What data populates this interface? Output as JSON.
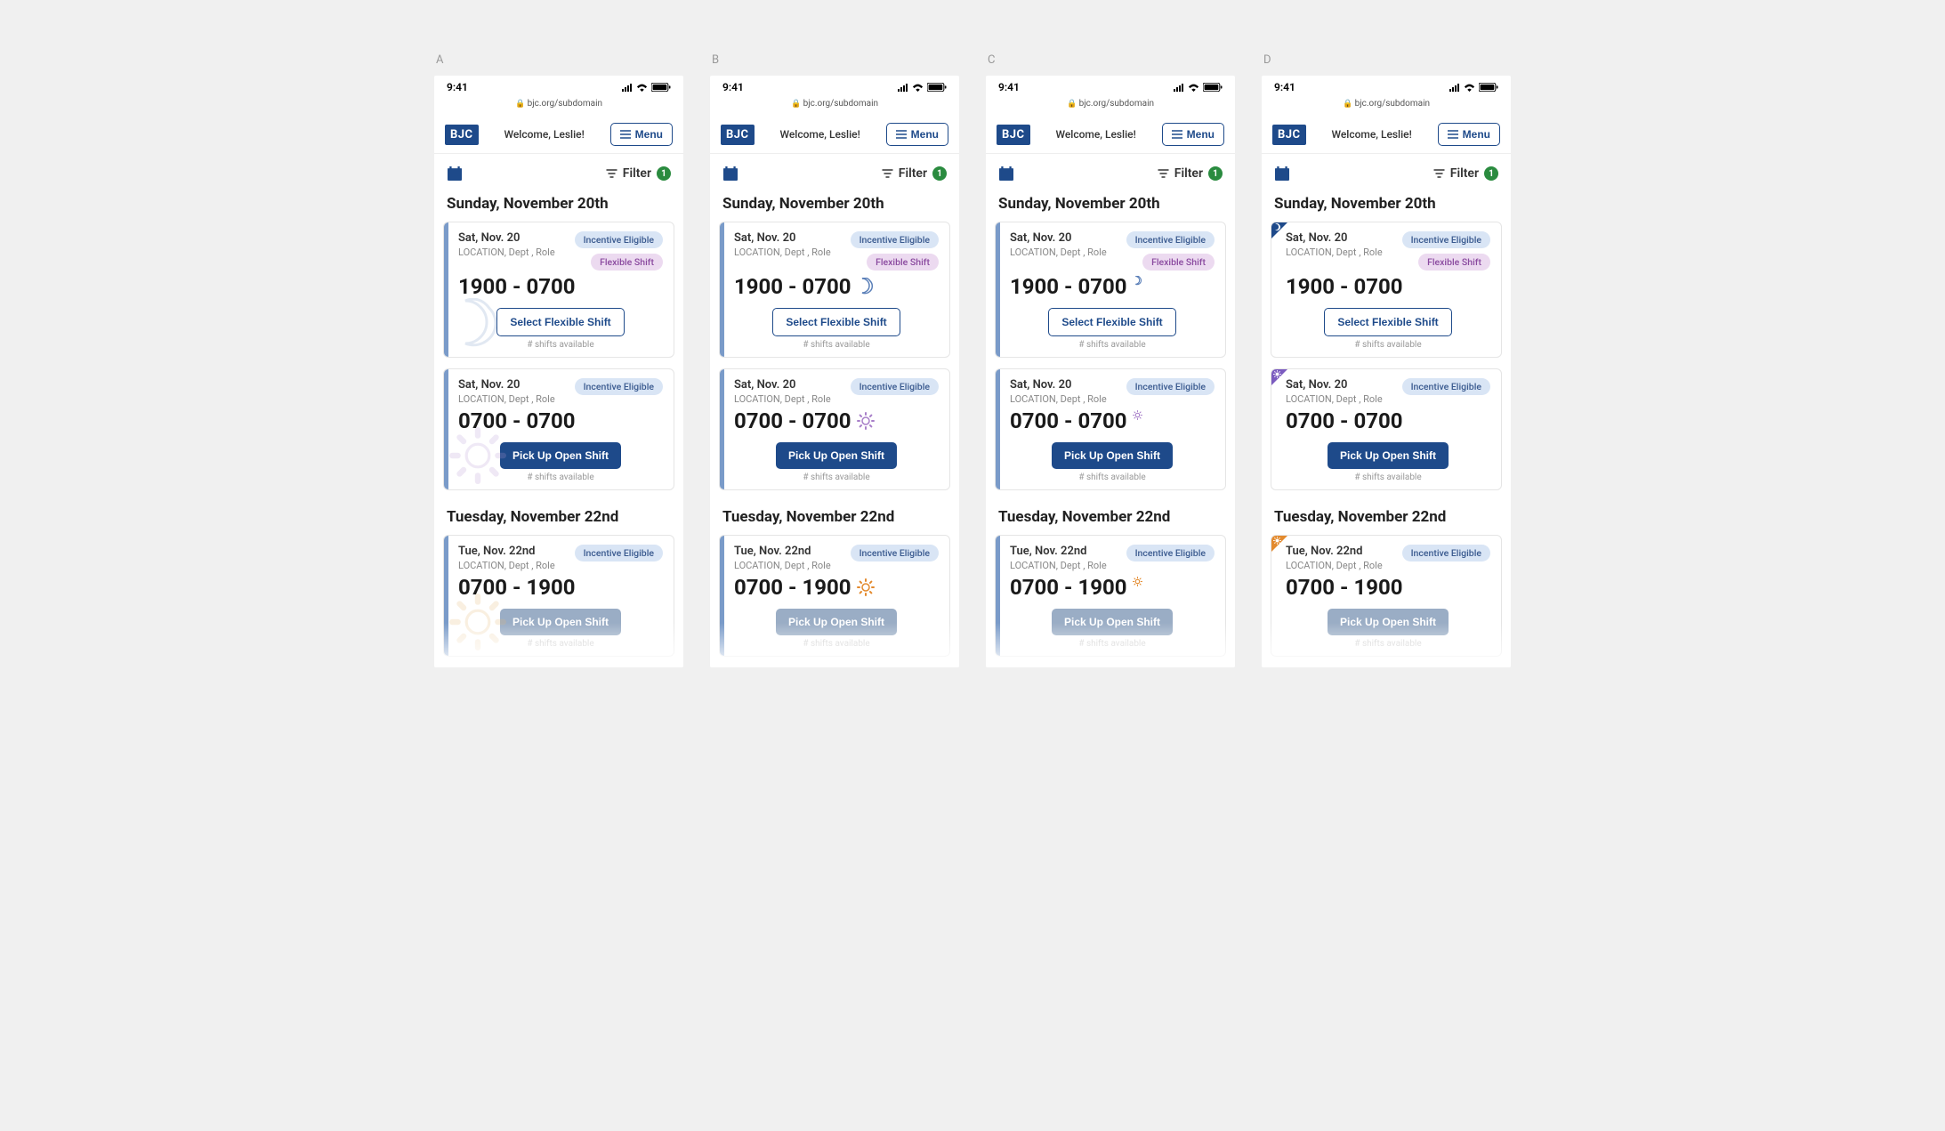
{
  "variants": [
    "A",
    "B",
    "C",
    "D"
  ],
  "status": {
    "time": "9:41"
  },
  "url": "bjc.org/subdomain",
  "header": {
    "logo": "BJC",
    "welcome": "Welcome, Leslie!",
    "menu_label": "Menu"
  },
  "filter": {
    "label": "Filter",
    "count": "1"
  },
  "day1": {
    "header": "Sunday, November 20th"
  },
  "day2": {
    "header": "Tuesday, November 22nd"
  },
  "card1": {
    "date": "Sat, Nov. 20",
    "meta": "LOCATION, Dept , Role",
    "time": "1900 - 0700",
    "badge_incentive": "Incentive Eligible",
    "badge_flex": "Flexible Shift",
    "button": "Select Flexible Shift",
    "avail": "# shifts available"
  },
  "card2": {
    "date": "Sat, Nov. 20",
    "meta": "LOCATION, Dept , Role",
    "time": "0700 - 0700",
    "badge_incentive": "Incentive Eligible",
    "button": "Pick Up Open Shift",
    "avail": "# shifts available"
  },
  "card3": {
    "date": "Tue, Nov. 22nd",
    "meta": "LOCATION, Dept , Role",
    "time": "0700 - 1900",
    "badge_incentive": "Incentive Eligible",
    "button": "Pick Up Open Shift",
    "avail": "# shifts available"
  },
  "variant_config": {
    "A": {
      "stripe": true,
      "corner": null,
      "icon1": "bg-moon",
      "icon2": "bg-sun-purple",
      "icon3": "bg-sun-orange"
    },
    "B": {
      "stripe": true,
      "corner": null,
      "icon1": "inline-moon-lg",
      "icon2": "inline-sun-purple-lg",
      "icon3": "inline-sun-orange-lg"
    },
    "C": {
      "stripe": true,
      "corner": null,
      "icon1": "inline-moon-sm",
      "icon2": "inline-sun-purple-sm",
      "icon3": "inline-sun-orange-sm"
    },
    "D": {
      "stripe": false,
      "corner": [
        "blue",
        "purple",
        "orange"
      ],
      "icon1": null,
      "icon2": null,
      "icon3": null
    }
  }
}
